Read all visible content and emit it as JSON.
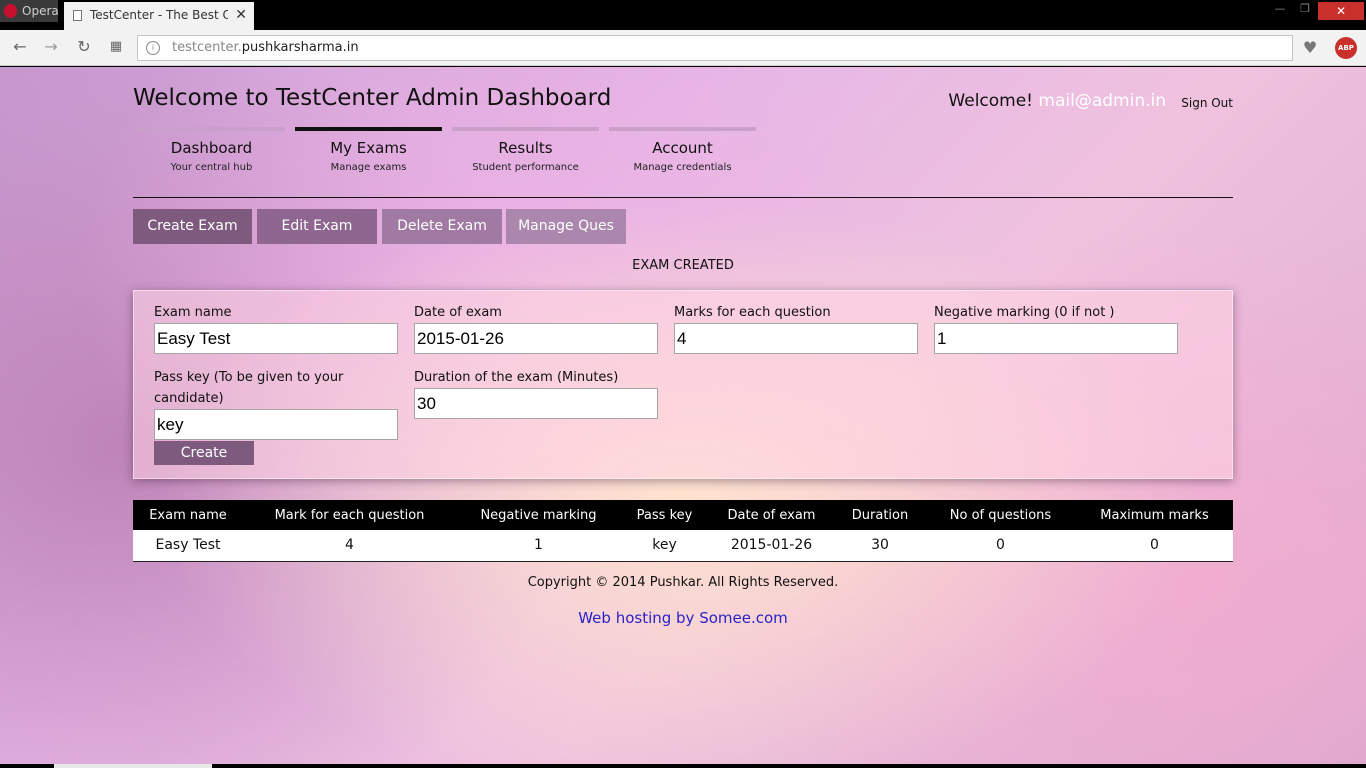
{
  "browser": {
    "menu_label": "Opera",
    "tab_title": "TestCenter - The Best Onli",
    "tab_close": "✕",
    "url_prefix": "testcenter.",
    "url_domain": "pushkarsharma.in",
    "icons": [
      "opera-logo-icon",
      "page-icon",
      "close-icon",
      "back-icon",
      "forward-icon",
      "reload-icon",
      "speed-dial-icon",
      "site-info-icon",
      "heart-icon",
      "adblock-icon"
    ],
    "adblock_label": "ABP"
  },
  "header": {
    "title": "Welcome to TestCenter Admin Dashboard",
    "welcome_text": "Welcome!",
    "user_email": "mail@admin.in",
    "sign_out": "Sign Out"
  },
  "nav": {
    "items": [
      {
        "title": "Dashboard",
        "subtitle": "Your central hub"
      },
      {
        "title": "My Exams",
        "subtitle": "Manage exams",
        "active": true
      },
      {
        "title": "Results",
        "subtitle": "Student performance"
      },
      {
        "title": "Account",
        "subtitle": "Manage credentials"
      }
    ]
  },
  "actions": {
    "create": "Create Exam",
    "edit": "Edit Exam",
    "delete": "Delete Exam",
    "manage": "Manage Ques"
  },
  "status_message": "EXAM CREATED",
  "form": {
    "exam_name": {
      "label": "Exam name",
      "value": "Easy Test"
    },
    "date": {
      "label": "Date of exam",
      "value": "2015-01-26"
    },
    "marks": {
      "label": "Marks for each question",
      "value": "4"
    },
    "negative": {
      "label": "Negative marking (0 if not )",
      "value": "1"
    },
    "pass_key": {
      "label": "Pass key (To be given to your candidate)",
      "value": "key"
    },
    "duration": {
      "label": "Duration of the exam (Minutes)",
      "value": "30"
    },
    "submit_label": "Create"
  },
  "table": {
    "headers": [
      "Exam name",
      "Mark for each question",
      "Negative marking",
      "Pass key",
      "Date of exam",
      "Duration",
      "No of questions",
      "Maximum marks"
    ],
    "rows": [
      [
        "Easy Test",
        "4",
        "1",
        "key",
        "2015-01-26",
        "30",
        "0",
        "0"
      ]
    ]
  },
  "footer": {
    "copyright": "Copyright © 2014 Pushkar. All Rights Reserved.",
    "hosting": "Web hosting by Somee.com"
  },
  "colors": {
    "accent_purple": "#7f5a7f",
    "table_header": "#000000",
    "hosting_link": "#2a22c8",
    "email_text": "#ffffff"
  }
}
